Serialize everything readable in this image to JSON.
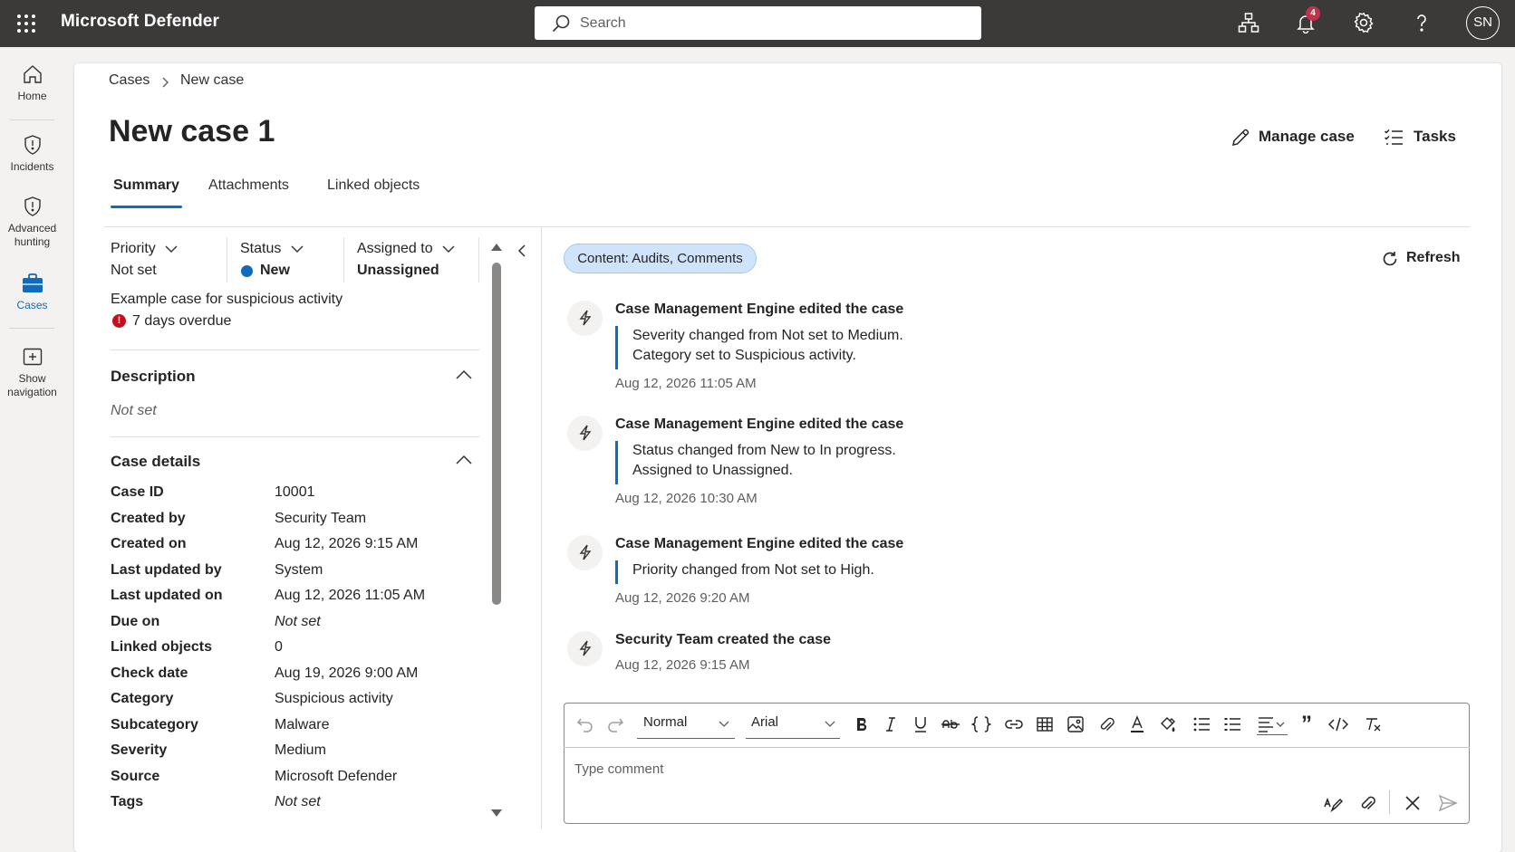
{
  "app": {
    "title": "Microsoft Defender",
    "avatar_initials": "SN",
    "notification_count": "4"
  },
  "search": {
    "placeholder": "Search"
  },
  "leftnav": {
    "home": "Home",
    "incidents": "Incidents",
    "advanced_hunting": "Advanced hunting",
    "cases": "Cases",
    "show_navigation": "Show navigation"
  },
  "breadcrumb": {
    "root": "Cases",
    "current": "New case"
  },
  "page": {
    "title": "New case 1",
    "manage_case": "Manage case",
    "tasks": "Tasks"
  },
  "tabs": [
    "Summary",
    "Attachments",
    "Linked objects"
  ],
  "summary": {
    "priority_label": "Priority",
    "priority_value": "Not set",
    "status_label": "Status",
    "status_value": "New",
    "assigned_label": "Assigned to",
    "assigned_value": "Unassigned",
    "case_name": "Example case for suspicious activity",
    "overdue": "7 days overdue",
    "overdue_icon": "!",
    "description_title": "Description",
    "description_value": "Not set",
    "details_title": "Case details",
    "details": [
      {
        "label": "Case ID",
        "value": "10001"
      },
      {
        "label": "Created by",
        "value": "Security Team"
      },
      {
        "label": "Created on",
        "value": "Aug 12, 2026 9:15 AM"
      },
      {
        "label": "Last updated by",
        "value": "System"
      },
      {
        "label": "Last updated on",
        "value": "Aug 12, 2026 11:05 AM"
      },
      {
        "label": "Due on",
        "value": "Not set"
      },
      {
        "label": "Linked objects",
        "value": "0"
      },
      {
        "label": "Check date",
        "value": "Aug 19, 2026 9:00 AM"
      },
      {
        "label": "Category",
        "value": "Suspicious activity"
      },
      {
        "label": "Subcategory",
        "value": "Malware"
      },
      {
        "label": "Severity",
        "value": "Medium"
      },
      {
        "label": "Source",
        "value": "Microsoft Defender"
      },
      {
        "label": "Tags",
        "value": "Not set"
      }
    ]
  },
  "activity": {
    "filter": "Content: Audits, Comments",
    "refresh": "Refresh",
    "entries": [
      {
        "title": "Case Management Engine edited the case",
        "lines": [
          "Severity changed from Not set to Medium.",
          "Category set to Suspicious activity."
        ],
        "time": "Aug 12, 2026 11:05 AM"
      },
      {
        "title": "Case Management Engine edited the case",
        "lines": [
          "Status changed from New to In progress.",
          "Assigned to Unassigned."
        ],
        "time": "Aug 12, 2026 10:30 AM"
      },
      {
        "title": "Case Management Engine edited the case",
        "lines": [
          "Priority changed from Not set to High."
        ],
        "time": "Aug 12, 2026 9:20 AM"
      },
      {
        "title": "Security Team created the case",
        "lines": [],
        "time": "Aug 12, 2026 9:15 AM"
      }
    ]
  },
  "editor": {
    "style_value": "Normal",
    "font_value": "Arial",
    "comment_placeholder": "Type comment",
    "quote_glyph": "”"
  },
  "colors": {
    "accent": "#0f6cbd",
    "topbar": "#3b3a39",
    "overdue": "#c50f1f",
    "chip": "#cfe4fa"
  }
}
